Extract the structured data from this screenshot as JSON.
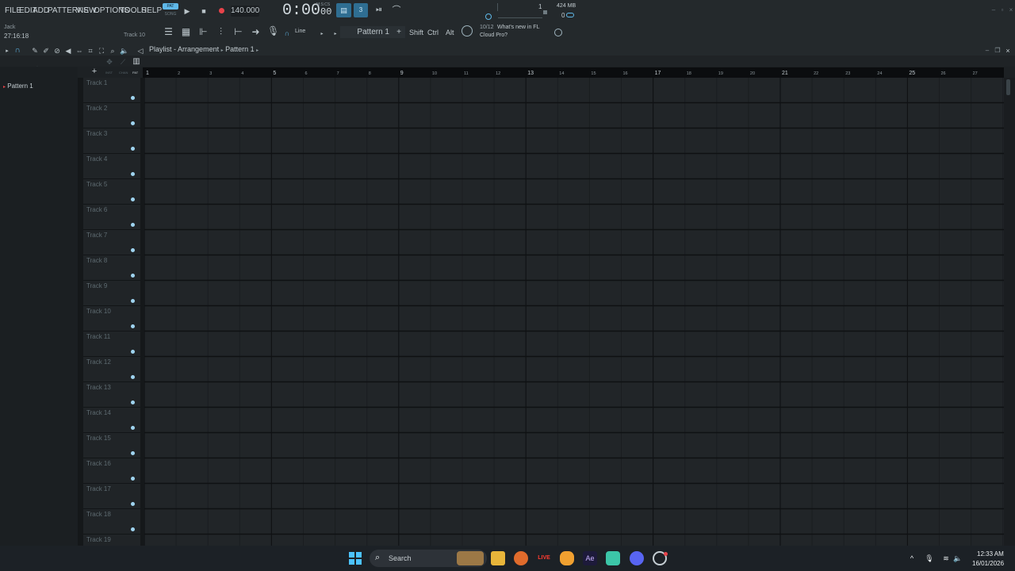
{
  "menu": {
    "file": "FILE",
    "edit": "EDIT",
    "add": "ADD",
    "patterns": "PATTERNS",
    "view": "VIEW",
    "options": "OPTIONS",
    "tools": "TOOLS",
    "help": "HELP"
  },
  "status": {
    "user": "Jack",
    "elapsed": "27:16:18",
    "track": "Track 10"
  },
  "transport": {
    "pat_label": "PAT",
    "song_label": "SONG",
    "tempo": "140.000",
    "time_main": "0:00",
    "time_sub": "00",
    "time_unit": "M:S:CS",
    "cpu": "1",
    "memory": "424 MB",
    "voices": "0"
  },
  "toolbar": {
    "snap_mode": "Line",
    "pattern": "Pattern 1",
    "shift": "Shift",
    "ctrl": "Ctrl",
    "alt": "Alt",
    "news_count": "10/12",
    "news_text_1": "What's new in FL",
    "news_text_2": "Cloud Pro?"
  },
  "playlist": {
    "crumb_1": "Playlist",
    "crumb_sep": "-",
    "crumb_2": "Arrangement",
    "crumb_3": "Pattern 1",
    "sub_labels": [
      "INST",
      "CHAN",
      "PAT"
    ]
  },
  "browser": {
    "items": [
      {
        "label": "Pattern 1"
      }
    ]
  },
  "ruler": [
    "1",
    "2",
    "3",
    "4",
    "5",
    "6",
    "7",
    "8",
    "9",
    "10",
    "11",
    "12",
    "13",
    "14",
    "15",
    "16",
    "17",
    "18",
    "19",
    "20",
    "21",
    "22",
    "23",
    "24",
    "25",
    "26",
    "27"
  ],
  "tracks": [
    "Track 1",
    "Track 2",
    "Track 3",
    "Track 4",
    "Track 5",
    "Track 6",
    "Track 7",
    "Track 8",
    "Track 9",
    "Track 10",
    "Track 11",
    "Track 12",
    "Track 13",
    "Track 14",
    "Track 15",
    "Track 16",
    "Track 17",
    "Track 18",
    "Track 19"
  ],
  "taskbar": {
    "search": "Search",
    "live": "LIVE",
    "ae": "Ae",
    "time": "12:33 AM",
    "date": "16/01/2026"
  },
  "colors": {
    "accent": "#5fb8e8",
    "grid_bg": "#212528",
    "track_dot": "#9fd4f0",
    "record": "#e8434a"
  }
}
